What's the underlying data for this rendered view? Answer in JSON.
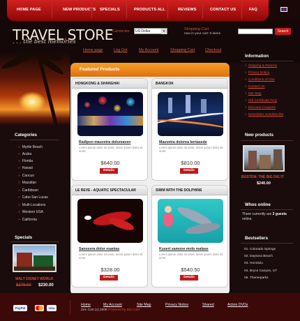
{
  "nav": {
    "items": [
      "HOME PAGE",
      "NEW PRODUCTS",
      "SPECIALS",
      "PRODUCTS ALL",
      "REVIEWS",
      "CONTACT US",
      "FAQ"
    ]
  },
  "brand": {
    "name": "TRAVEL",
    "dot": ".",
    "store": "STORE",
    "slogan": ". . . the best memories"
  },
  "currency": {
    "label": "Currencies:",
    "value": "US Dollar"
  },
  "cart": {
    "title": "Shopping Cart",
    "info": "now in your cart: 0 items"
  },
  "search": {
    "button": "Search",
    "value": ""
  },
  "top_links": [
    "Home page",
    "Log Out",
    "My Account",
    "Shopping Cart",
    "Checkout"
  ],
  "featured": {
    "title": "Featured Products",
    "products": [
      {
        "header": "HONGKONG & SHANGHAI",
        "title": "Radipon mauvetra doloreaven",
        "desc": "Lorem ipsum dolor sit amet, lorem ipsum dolor sit amet.",
        "price": "$640.00",
        "details": "Details"
      },
      {
        "header": "BANGKOK",
        "title": "Mauvetra dolorea kertasede",
        "desc": "Lorem ipsum dolor sit amet, lorem ipsum dolor sit amet.",
        "price": "$810.00",
        "details": "Details"
      },
      {
        "header": "LE REVE - AQUATIC SPECTACULAR",
        "title": "Sanusera dolor esanias",
        "desc": "Lorem ipsum dolor sit amet, lorem ipsum dolor sit amet.",
        "price": "$328.00",
        "details": "Details"
      },
      {
        "header": "SWIM WITH THE DOLPHINS",
        "title": "Kusert samone molo realase",
        "desc": "Lorem ipsum dolor sit amet, lorem ipsum dolor sit amet.",
        "price": "$540.50",
        "details": "Details"
      }
    ]
  },
  "categories": {
    "title": "Categories",
    "items": [
      "Myrtle Beach",
      "Aruba",
      "Florida",
      "Hawaii",
      "Cancun",
      "Mazatlan",
      "Caribbean",
      "Cabo San Lucas",
      "Multi-Locations",
      "Western USA",
      "California"
    ]
  },
  "specials": {
    "title": "Specials",
    "name": "WALT DISNEY WORLD",
    "old_price": "$279.00",
    "new_price": "$230.00"
  },
  "information": {
    "title": "Information",
    "items": [
      "Shipping & Returns",
      "Privacy Notice",
      "Conditions of Use",
      "Contact Us",
      "Site Map",
      "Gift Certificate FAQ",
      "Discount Coupons",
      "Newsletter Unsubscribe"
    ]
  },
  "new_products": {
    "title": "New products",
    "name": "BOSTON: THE BIG DIG IT",
    "price": "$240.00"
  },
  "whos_online": {
    "title": "Whos online",
    "text_1": "There currently are",
    "count": "2 guests",
    "text_2": "online."
  },
  "bestsellers": {
    "title": "Bestsellers",
    "items": [
      "01. Colorado Springs",
      "02. Daytona Beach",
      "03. Honolulu",
      "04. Bryce Canyon, UT",
      "05. Themeparks"
    ]
  },
  "footer": {
    "links": [
      "Home",
      "My Account",
      "Site Map",
      "Privacy Notice",
      "Shared",
      "Action DVDs"
    ],
    "copyright": "Zen Cart (c) 2009",
    "powered": "Powered by Zen Cart",
    "payments": [
      "PayPal",
      "VISA"
    ]
  },
  "colors": {
    "accent": "#c81818",
    "orange": "#f08a1e",
    "link": "#e04a3a"
  }
}
